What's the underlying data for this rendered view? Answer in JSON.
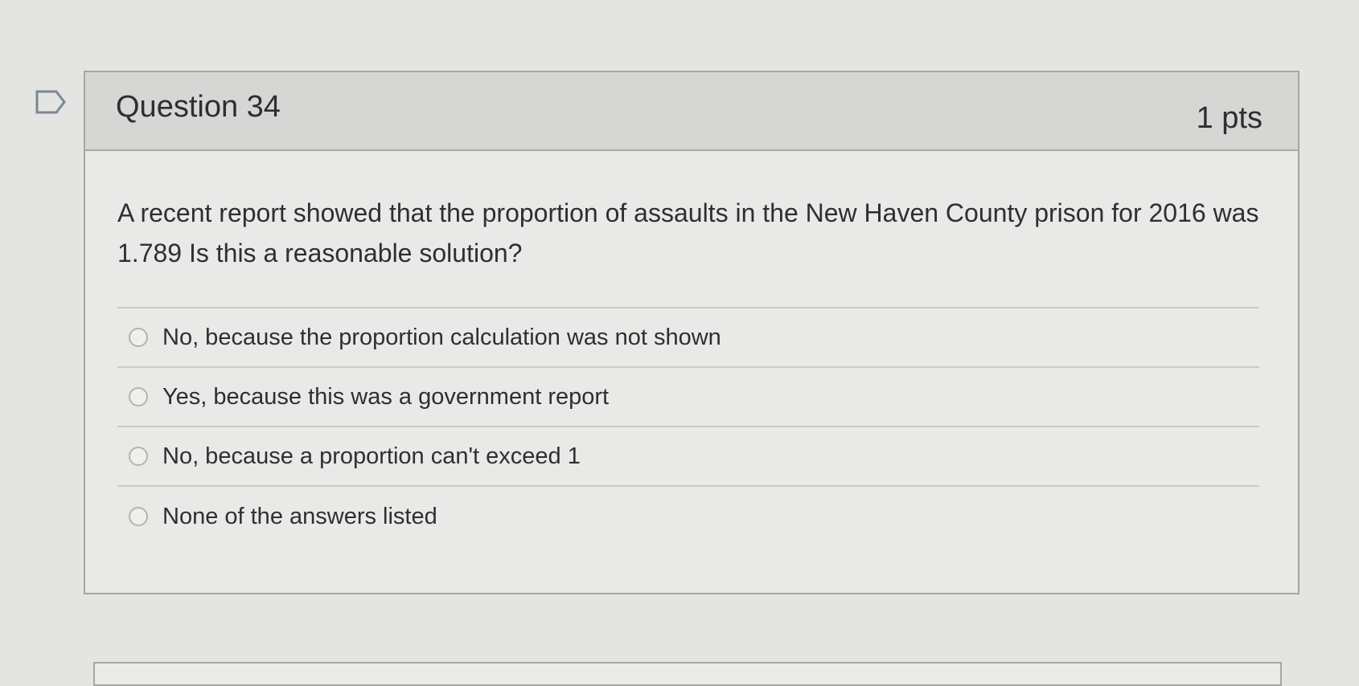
{
  "question": {
    "title": "Question 34",
    "points": "1 pts",
    "text": "A recent report showed that the proportion of assaults in the New Haven County prison for 2016 was 1.789 Is this a reasonable solution?"
  },
  "answers": [
    {
      "label": "No, because the proportion calculation was not shown"
    },
    {
      "label": "Yes, because this was a government report"
    },
    {
      "label": "No, because a proportion can't exceed 1"
    },
    {
      "label": "None of the answers listed"
    }
  ],
  "icons": {
    "flag": "flag-question-icon",
    "radio": "radio-button-icon"
  },
  "colors": {
    "page_background": "#e4e4e2",
    "header_background": "#d6d6d4",
    "card_background": "#e9e9e7",
    "text": "#2f2f2f"
  }
}
